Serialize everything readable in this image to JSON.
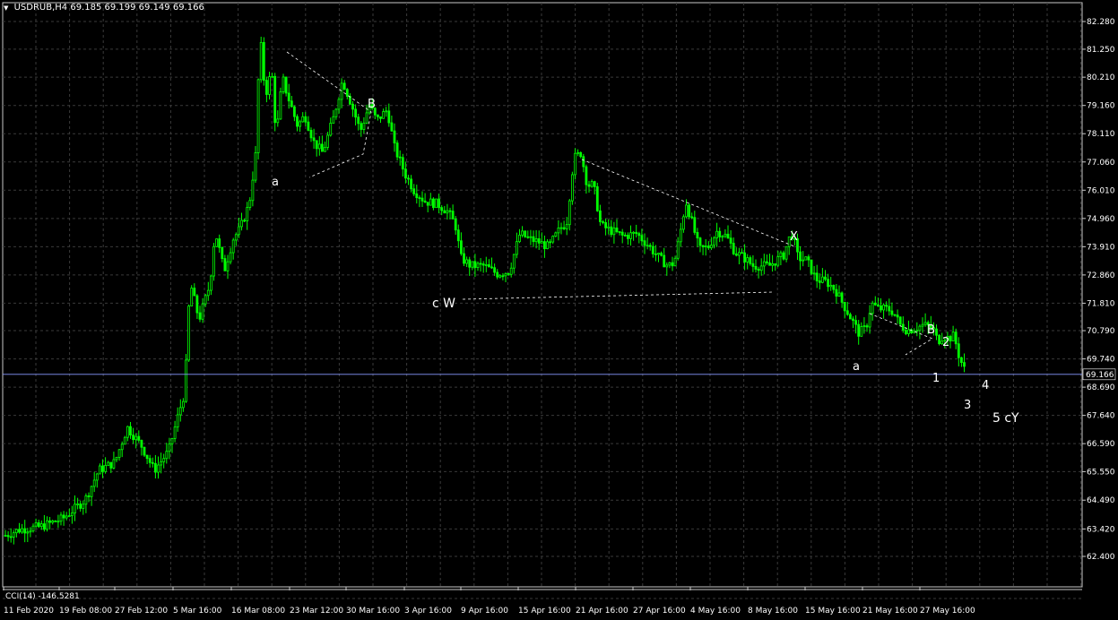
{
  "header": {
    "symbol": "USDRUB,H4",
    "ohlc": "69.185 69.199 69.149 69.166"
  },
  "indicator": {
    "label": "CCI(14) -146.5281"
  },
  "current_price_label": "69.166",
  "colors": {
    "background": "#000000",
    "grid": "#3a3a3a",
    "bull": "#00ff00",
    "bear": "#00ff00",
    "text": "#ffffff",
    "price_line": "#8899ff"
  },
  "chart_data": {
    "type": "candlestick",
    "title": "",
    "xlabel": "",
    "ylabel": "",
    "ylim": [
      61.9,
      82.8
    ],
    "grid": true,
    "price_ticks": [
      82.28,
      81.25,
      80.21,
      79.16,
      78.11,
      77.06,
      76.01,
      74.96,
      73.91,
      72.86,
      71.81,
      70.79,
      69.74,
      68.69,
      67.64,
      66.59,
      65.55,
      64.49,
      63.42,
      62.4
    ],
    "time_labels": [
      "11 Feb 2020",
      "19 Feb 08:00",
      "27 Feb 12:00",
      "5 Mar 16:00",
      "16 Mar 08:00",
      "23 Mar 12:00",
      "30 Mar 16:00",
      "3 Apr 16:00",
      "9 Apr 16:00",
      "15 Apr 16:00",
      "21 Apr 16:00",
      "27 Apr 16:00",
      "4 May 16:00",
      "8 May 16:00",
      "15 May 16:00",
      "21 May 16:00",
      "27 May 16:00"
    ],
    "current_price": 69.166,
    "price_path": [
      [
        0,
        63.1
      ],
      [
        22,
        63.4
      ],
      [
        45,
        63.5
      ],
      [
        70,
        63.8
      ],
      [
        95,
        64.5
      ],
      [
        110,
        65.6
      ],
      [
        128,
        65.9
      ],
      [
        142,
        67.2
      ],
      [
        158,
        66.5
      ],
      [
        172,
        65.6
      ],
      [
        188,
        66.3
      ],
      [
        200,
        67.8
      ],
      [
        206,
        68.5
      ],
      [
        212,
        72.6
      ],
      [
        222,
        71.2
      ],
      [
        234,
        72.5
      ],
      [
        240,
        74.5
      ],
      [
        250,
        73.0
      ],
      [
        260,
        74.2
      ],
      [
        268,
        74.6
      ],
      [
        278,
        75.5
      ],
      [
        285,
        77.3
      ],
      [
        290,
        81.8
      ],
      [
        296,
        79.5
      ],
      [
        303,
        80.5
      ],
      [
        308,
        78.0
      ],
      [
        315,
        80.2
      ],
      [
        320,
        79.6
      ],
      [
        326,
        79.0
      ],
      [
        332,
        78.4
      ],
      [
        340,
        78.8
      ],
      [
        350,
        77.8
      ],
      [
        360,
        77.4
      ],
      [
        372,
        78.7
      ],
      [
        382,
        80.1
      ],
      [
        392,
        79.2
      ],
      [
        402,
        78.2
      ],
      [
        412,
        79.2
      ],
      [
        420,
        78.6
      ],
      [
        432,
        79.0
      ],
      [
        440,
        77.6
      ],
      [
        452,
        76.6
      ],
      [
        462,
        76.0
      ],
      [
        474,
        75.6
      ],
      [
        488,
        75.5
      ],
      [
        500,
        75.2
      ],
      [
        508,
        74.7
      ],
      [
        514,
        73.5
      ],
      [
        525,
        73.2
      ],
      [
        540,
        73.2
      ],
      [
        555,
        72.9
      ],
      [
        568,
        73.0
      ],
      [
        580,
        74.4
      ],
      [
        590,
        74.2
      ],
      [
        600,
        74.1
      ],
      [
        612,
        73.9
      ],
      [
        625,
        74.6
      ],
      [
        632,
        74.8
      ],
      [
        640,
        77.2
      ],
      [
        648,
        77.4
      ],
      [
        655,
        76.2
      ],
      [
        662,
        76.2
      ],
      [
        670,
        74.7
      ],
      [
        682,
        74.5
      ],
      [
        695,
        74.3
      ],
      [
        710,
        74.4
      ],
      [
        722,
        74.0
      ],
      [
        735,
        73.5
      ],
      [
        745,
        73.2
      ],
      [
        752,
        73.3
      ],
      [
        758,
        74.3
      ],
      [
        765,
        75.6
      ],
      [
        772,
        74.8
      ],
      [
        780,
        73.8
      ],
      [
        790,
        73.9
      ],
      [
        800,
        74.5
      ],
      [
        810,
        74.3
      ],
      [
        820,
        73.7
      ],
      [
        830,
        73.5
      ],
      [
        840,
        73.2
      ],
      [
        850,
        73.2
      ],
      [
        858,
        73.2
      ],
      [
        866,
        73.4
      ],
      [
        874,
        73.6
      ],
      [
        880,
        74.2
      ],
      [
        884,
        74.4
      ],
      [
        890,
        73.5
      ],
      [
        900,
        73.4
      ],
      [
        910,
        72.7
      ],
      [
        922,
        72.6
      ],
      [
        932,
        72.3
      ],
      [
        940,
        71.8
      ],
      [
        950,
        71.2
      ],
      [
        958,
        70.7
      ],
      [
        966,
        70.9
      ],
      [
        972,
        71.8
      ],
      [
        980,
        71.6
      ],
      [
        990,
        71.6
      ],
      [
        996,
        71.5
      ],
      [
        1004,
        71.0
      ],
      [
        1012,
        70.8
      ],
      [
        1022,
        70.9
      ],
      [
        1030,
        71.0
      ],
      [
        1040,
        70.9
      ],
      [
        1046,
        70.4
      ],
      [
        1052,
        70.6
      ],
      [
        1058,
        70.5
      ],
      [
        1064,
        70.6
      ],
      [
        1070,
        69.8
      ],
      [
        1078,
        69.17
      ]
    ],
    "trendlines": [
      {
        "from": [
          "23 Mar 12:00",
          81.25
        ],
        "to": [
          "30 Mar 16:00",
          79.16
        ],
        "style": "dashed"
      },
      {
        "from": [
          "21 Apr 16:00",
          77.06
        ],
        "to": [
          "15 May 16:00",
          74.6
        ],
        "style": "dashed"
      }
    ],
    "annotations": [
      "a",
      "B",
      "c W",
      "X",
      "a",
      "B",
      "1",
      "2",
      "3",
      "4",
      "5 cY"
    ]
  }
}
